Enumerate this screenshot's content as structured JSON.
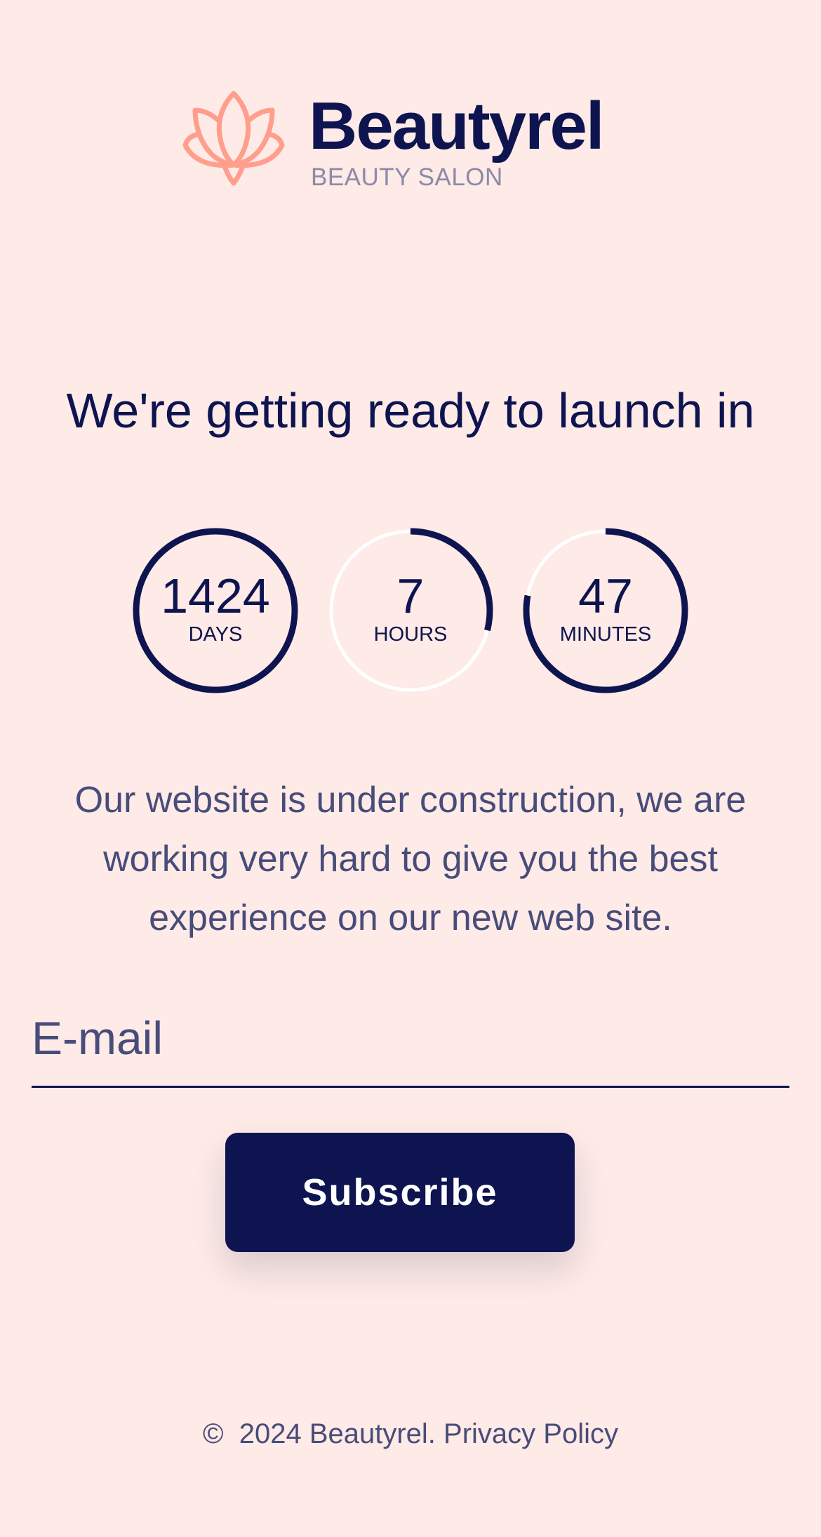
{
  "brand": {
    "name": "Beautyrel",
    "tagline": "BEAUTY SALON",
    "logo_icon": "lotus-icon"
  },
  "colors": {
    "background": "#FEEAE6",
    "primary": "#0E1450",
    "accent": "#FF9E8C",
    "text_secondary": "#484C7A",
    "ring_track": "#FFFFFF"
  },
  "headline": "We're getting ready to launch in",
  "countdown": [
    {
      "value": "1424",
      "label": "DAYS",
      "progress": 1.0
    },
    {
      "value": "7",
      "label": "HOURS",
      "progress": 0.29
    },
    {
      "value": "47",
      "label": "MINUTES",
      "progress": 0.78
    }
  ],
  "description": "Our website is under construction, we are working very hard to give you the best experience on our new web site.",
  "form": {
    "email_placeholder": "E-mail",
    "email_value": "",
    "subscribe_label": "Subscribe"
  },
  "footer": {
    "copyright_symbol": "©",
    "copyright_text": "2024 Beautyrel.",
    "privacy_label": "Privacy Policy"
  }
}
